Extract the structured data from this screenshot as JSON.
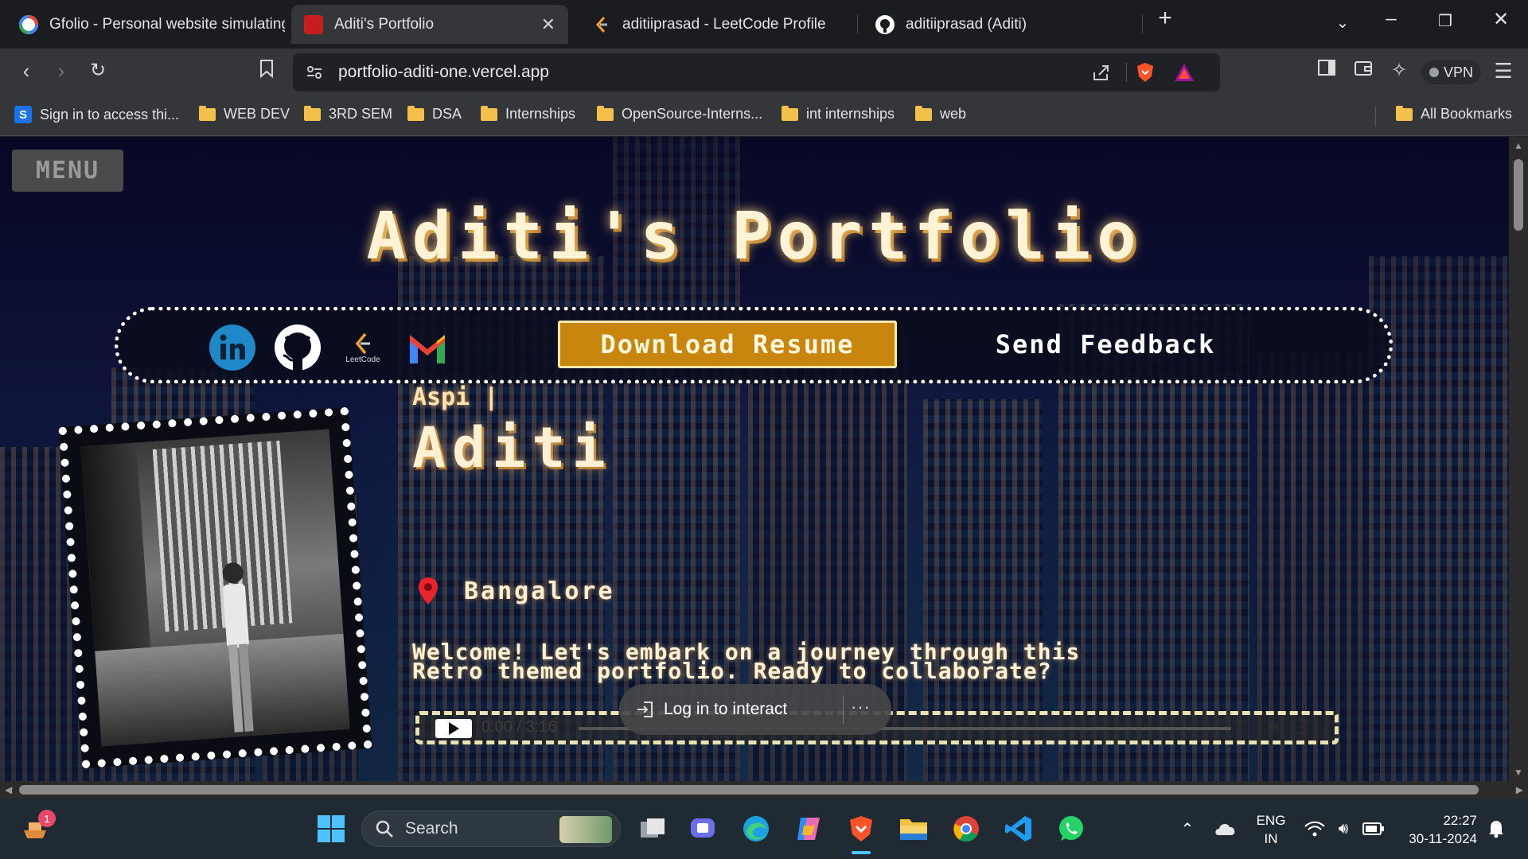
{
  "browser": {
    "tabs": [
      {
        "title": "Gfolio - Personal website simulating",
        "active": false
      },
      {
        "title": "Aditi's Portfolio",
        "active": true
      },
      {
        "title": "aditiiprasad - LeetCode Profile",
        "active": false
      },
      {
        "title": "aditiiprasad (Aditi)",
        "active": false
      }
    ],
    "url": "portfolio-aditi-one.vercel.app",
    "vpn_label": "VPN",
    "bookmarks": [
      {
        "label": "Sign in to access thi...",
        "icon": "s-logo-icon"
      },
      {
        "label": "WEB DEV",
        "icon": "folder-icon"
      },
      {
        "label": "3RD SEM",
        "icon": "folder-icon"
      },
      {
        "label": "DSA",
        "icon": "folder-icon"
      },
      {
        "label": "Internships",
        "icon": "folder-icon"
      },
      {
        "label": "OpenSource-Interns...",
        "icon": "folder-icon"
      },
      {
        "label": "int internships",
        "icon": "folder-icon"
      },
      {
        "label": "web",
        "icon": "folder-icon"
      }
    ],
    "all_bookmarks": "All Bookmarks"
  },
  "page": {
    "menu_label": "MENU",
    "title": "Aditi's Portfolio",
    "social": [
      "linkedin-icon",
      "github-icon",
      "leetcode-icon",
      "gmail-icon"
    ],
    "leetcode_caption": "LeetCode",
    "download_resume": "Download Resume",
    "send_feedback": "Send Feedback",
    "greeting": "Aspi",
    "name": "Aditi",
    "location": "Bangalore",
    "welcome_line1": "Welcome! Let's embark on a journey through this",
    "welcome_line2": "Retro themed portfolio. Ready to collaborate?",
    "audio_time": "0:00 / 3:16",
    "audio_progress": 0,
    "login_prompt": "Log in to interact"
  },
  "taskbar": {
    "search_label": "Search",
    "notification_count": "1",
    "lang_line1": "ENG",
    "lang_line2": "IN",
    "time": "22:27",
    "date": "30-11-2024"
  },
  "colors": {
    "accent": "#c9860f",
    "title_glow": "#ffd27a"
  }
}
